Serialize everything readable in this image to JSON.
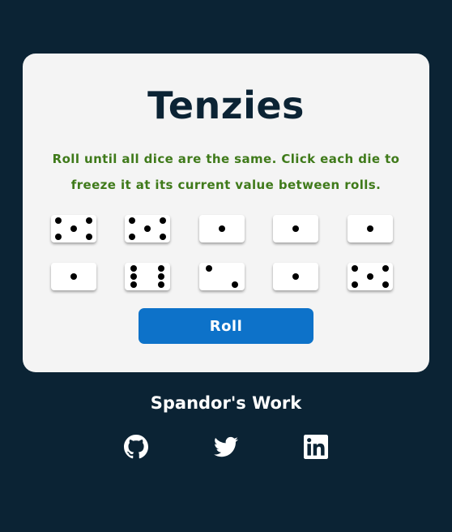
{
  "game": {
    "title": "Tenzies",
    "instructions": "Roll until all dice are the same. Click each die to freeze it at its current value between rolls.",
    "dice": [
      5,
      5,
      1,
      1,
      1,
      1,
      6,
      2,
      1,
      5
    ],
    "roll_label": "Roll"
  },
  "footer": {
    "title": "Spandor's Work",
    "links": [
      {
        "name": "github-icon"
      },
      {
        "name": "twitter-icon"
      },
      {
        "name": "linkedin-icon"
      }
    ]
  },
  "colors": {
    "background": "#0b2334",
    "card": "#f4f4f4",
    "title": "#0b2334",
    "instructions": "#3f7a1a",
    "roll_button": "#0d72c9"
  }
}
